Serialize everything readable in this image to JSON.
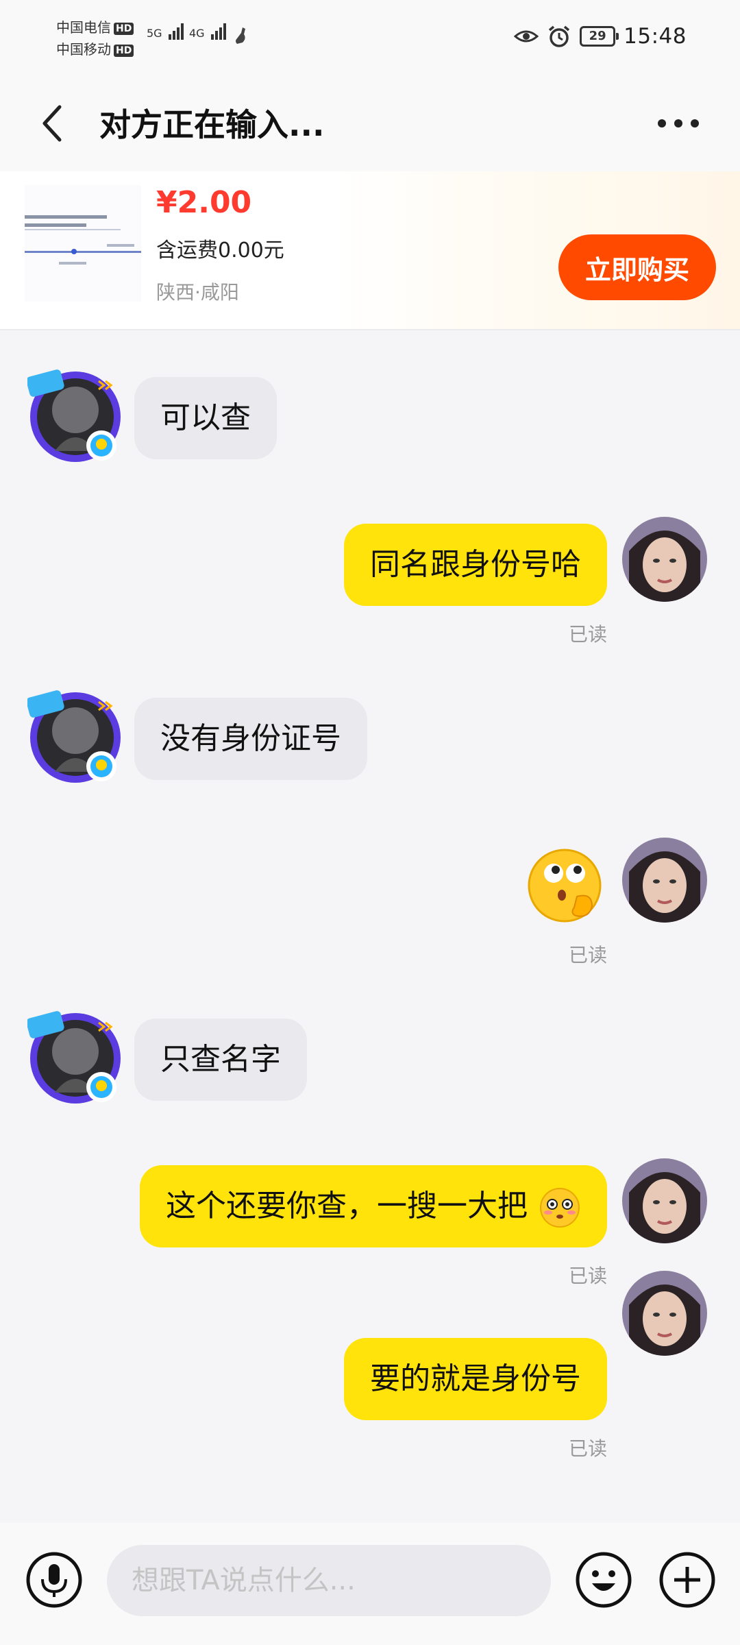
{
  "status_bar": {
    "carrier_1": "中国电信",
    "carrier_2": "中国移动",
    "hd": "HD",
    "sig_1": "5G",
    "sig_2": "4G",
    "battery": "29",
    "time": "15:48"
  },
  "header": {
    "title": "对方正在输入..."
  },
  "product": {
    "price": "¥2.00",
    "shipping": "含运费0.00元",
    "location": "陕西·咸阳",
    "buy_label": "立即购买"
  },
  "messages": [
    {
      "from": "other",
      "text": "可以查"
    },
    {
      "from": "me",
      "text": "同名跟身份号哈",
      "status": "已读"
    },
    {
      "from": "other",
      "text": "没有身份证号"
    },
    {
      "from": "me",
      "emoji": "thinking-face",
      "status": "已读"
    },
    {
      "from": "other",
      "text": "只查名字"
    },
    {
      "from": "me",
      "text": "这个还要你查，一搜一大把",
      "emoji": "flushed-face",
      "status": "已读"
    },
    {
      "from": "me",
      "text": "要的就是身份号",
      "status": "已读"
    }
  ],
  "input": {
    "placeholder": "想跟TA说点什么..."
  },
  "colors": {
    "accent_yellow": "#ffe30a",
    "buy_orange": "#ff4a00",
    "price_red": "#ff3b30"
  }
}
